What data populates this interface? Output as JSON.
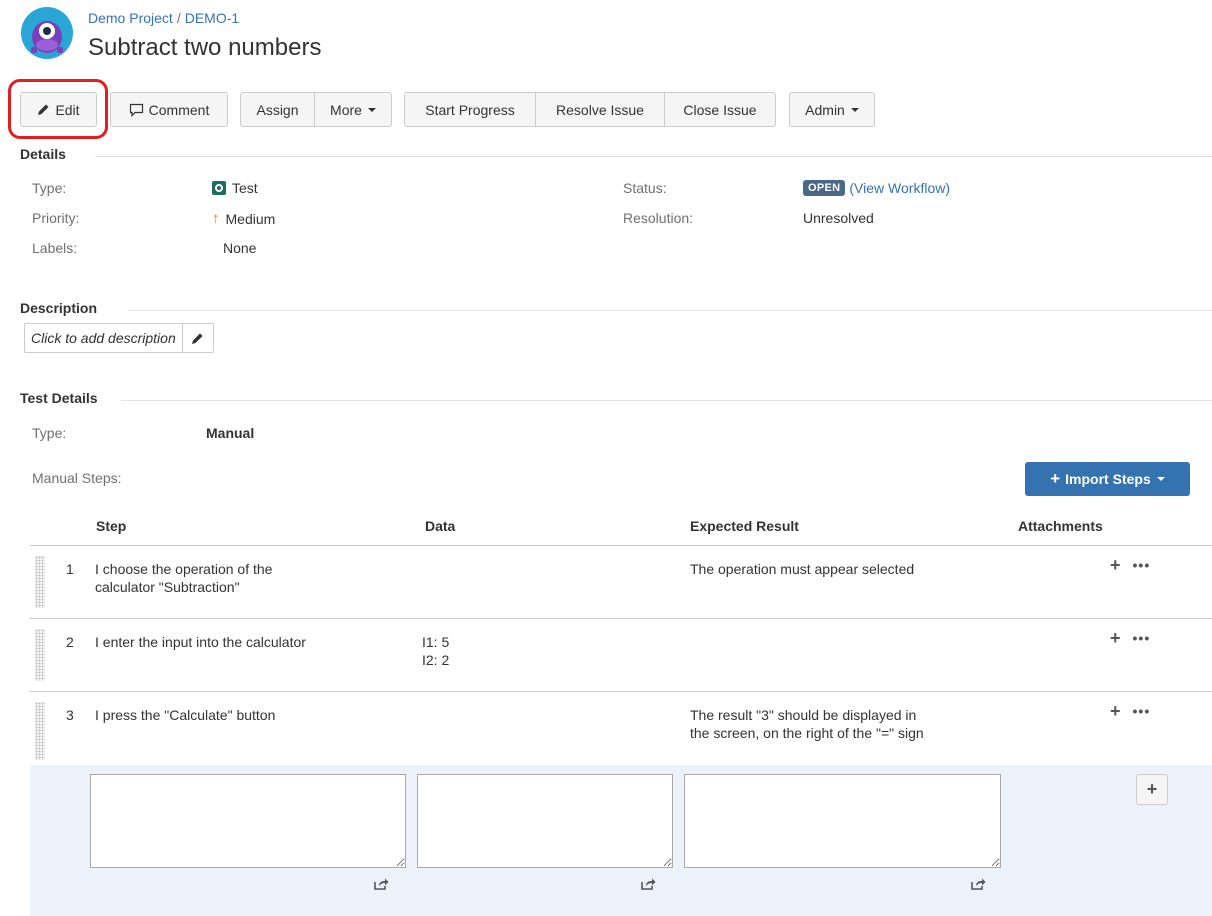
{
  "breadcrumb": {
    "project": "Demo Project",
    "separator": "/",
    "issue_key": "DEMO-1"
  },
  "title": "Subtract two numbers",
  "toolbar": {
    "edit": "Edit",
    "comment": "Comment",
    "assign": "Assign",
    "more": "More",
    "start_progress": "Start Progress",
    "resolve_issue": "Resolve Issue",
    "close_issue": "Close Issue",
    "admin": "Admin"
  },
  "details": {
    "heading": "Details",
    "type_label": "Type:",
    "type_value": "Test",
    "priority_label": "Priority:",
    "priority_value": "Medium",
    "labels_label": "Labels:",
    "labels_value": "None",
    "status_label": "Status:",
    "status_value": "OPEN",
    "view_workflow": "View Workflow",
    "resolution_label": "Resolution:",
    "resolution_value": "Unresolved"
  },
  "description": {
    "heading": "Description",
    "placeholder": "Click to add description"
  },
  "test_details": {
    "heading": "Test Details",
    "type_label": "Type:",
    "type_value": "Manual",
    "manual_steps_label": "Manual Steps:",
    "import_steps": "Import Steps"
  },
  "steps_table": {
    "headers": {
      "step": "Step",
      "data": "Data",
      "expected": "Expected Result",
      "attachments": "Attachments"
    },
    "rows": [
      {
        "num": "1",
        "step_line1": "I choose the operation of the",
        "step_line2": "calculator \"Subtraction\"",
        "data_line1": "",
        "data_line2": "",
        "expected_line1": "The operation must appear selected",
        "expected_line2": ""
      },
      {
        "num": "2",
        "step_line1": "I enter the input into the calculator",
        "step_line2": "",
        "data_line1": "I1: 5",
        "data_line2": "I2: 2",
        "expected_line1": "",
        "expected_line2": ""
      },
      {
        "num": "3",
        "step_line1": "I press the \"Calculate\" button",
        "step_line2": "",
        "data_line1": "",
        "data_line2": "",
        "expected_line1": "The result \"3\" should be displayed in",
        "expected_line2": "the screen, on the right of the \"=\" sign"
      }
    ]
  },
  "icons": {
    "avatar": "project-avatar-icon",
    "edit": "pencil-icon",
    "comment": "speech-bubble-icon",
    "add": "plus-icon",
    "more_actions": "ellipsis-icon",
    "share": "share-icon"
  },
  "colors": {
    "accent": "#3572b0",
    "status_badge": "#4a6785",
    "highlight": "#e02020",
    "new_row_bg": "#ebf2f9"
  }
}
